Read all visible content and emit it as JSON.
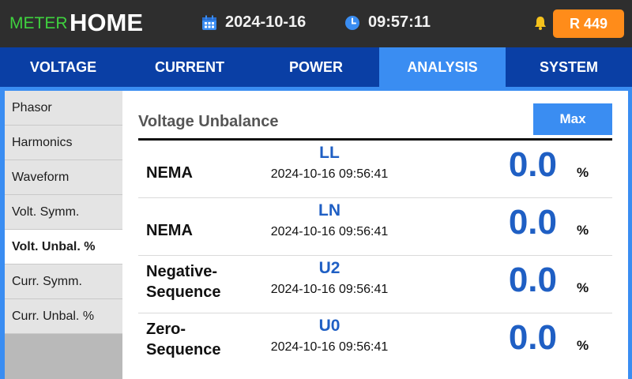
{
  "header": {
    "brand_prefix": "METER",
    "brand_title": "HOME",
    "date": "2024-10-16",
    "time": "09:57:11",
    "badge": "R 449",
    "colors": {
      "brand_prefix": "#3fd13f",
      "badge": "#ff8c1a",
      "header_bg": "#2e2e2e"
    },
    "icons": [
      "calendar-icon",
      "clock-icon",
      "bell-icon"
    ]
  },
  "tabs": [
    {
      "label": "VOLTAGE",
      "active": false
    },
    {
      "label": "CURRENT",
      "active": false
    },
    {
      "label": "POWER",
      "active": false
    },
    {
      "label": "ANALYSIS",
      "active": true
    },
    {
      "label": "SYSTEM",
      "active": false
    }
  ],
  "sidebar": {
    "items": [
      {
        "label": "Phasor",
        "active": false
      },
      {
        "label": "Harmonics",
        "active": false
      },
      {
        "label": "Waveform",
        "active": false
      },
      {
        "label": "Volt. Symm.",
        "active": false
      },
      {
        "label": "Volt. Unbal. %",
        "active": true
      },
      {
        "label": "Curr. Symm.",
        "active": false
      },
      {
        "label": "Curr. Unbal. %",
        "active": false
      }
    ]
  },
  "main": {
    "title": "Voltage Unbalance",
    "max_button": "Max",
    "rows": [
      {
        "label_line1": "NEMA",
        "label_line2": "",
        "code": "LL",
        "timestamp": "2024-10-16 09:56:41",
        "value": "0.0",
        "unit": "%"
      },
      {
        "label_line1": "NEMA",
        "label_line2": "",
        "code": "LN",
        "timestamp": "2024-10-16 09:56:41",
        "value": "0.0",
        "unit": "%"
      },
      {
        "label_line1": "Negative-",
        "label_line2": "Sequence",
        "code": "U2",
        "timestamp": "2024-10-16 09:56:41",
        "value": "0.0",
        "unit": "%"
      },
      {
        "label_line1": "Zero-",
        "label_line2": "Sequence",
        "code": "U0",
        "timestamp": "2024-10-16 09:56:41",
        "value": "0.0",
        "unit": "%"
      }
    ]
  },
  "colors": {
    "tab_bar": "#0a3fa5",
    "accent": "#3a8df2",
    "value_blue": "#1f5fc4"
  }
}
